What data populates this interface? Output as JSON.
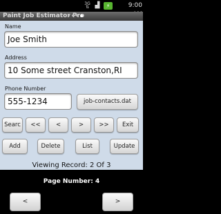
{
  "status_bar": {
    "network_label": "3G",
    "time": "9:00 AM",
    "icons": [
      "network-3g-icon",
      "signal-icon",
      "battery-icon"
    ],
    "battery_color": "#58b530"
  },
  "app": {
    "title": "Paint Job Estimator Pro",
    "page_indicator": {
      "count": 4,
      "active_index": 3
    }
  },
  "form": {
    "name_label": "Name",
    "name_value": "Joe Smith",
    "address_label": "Address",
    "address_value": "10 Some street  Cranston,RI",
    "phone_label": "Phone Number",
    "phone_value": "555-1234",
    "contacts_file_button": "job-contacts.dat"
  },
  "nav_buttons": {
    "search": "Searc",
    "first": "<<",
    "prev": "<",
    "next": ">",
    "last": ">>",
    "exit": "Exit"
  },
  "action_buttons": {
    "add": "Add",
    "delete": "Delete",
    "list": "List",
    "update": "Update"
  },
  "record_info": "Viewing Record: 2 Of 3",
  "pagination": {
    "page_number_text": "Page Number: 4",
    "prev_label": "<",
    "next_label": ">"
  },
  "colors": {
    "content_background": "#cfdbe9",
    "screen_background": "#000000"
  }
}
